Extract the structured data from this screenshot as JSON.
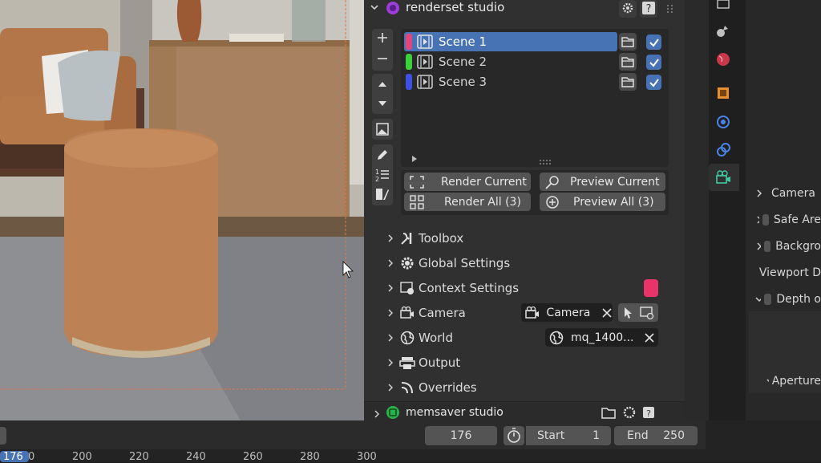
{
  "addon_header": {
    "title": "renderset studio"
  },
  "scenes": [
    {
      "name": "Scene 1",
      "color": "#e0467c",
      "selected": true,
      "checked": true
    },
    {
      "name": "Scene 2",
      "color": "#3ccf3c",
      "selected": false,
      "checked": true
    },
    {
      "name": "Scene 3",
      "color": "#3f50e0",
      "selected": false,
      "checked": true
    }
  ],
  "render_buttons": {
    "render_current": "Render Current",
    "preview_current": "Preview Current",
    "render_all": "Render All (3)",
    "preview_all": "Preview All (3)"
  },
  "sections": {
    "toolbox": "Toolbox",
    "global_settings": "Global Settings",
    "context_settings": "Context Settings",
    "camera": "Camera",
    "world": "World",
    "output": "Output",
    "overrides": "Overrides"
  },
  "context_color": "#e8336b",
  "camera_field": {
    "value": "Camera"
  },
  "world_field": {
    "value": "mq_1400..."
  },
  "memsaver_header": {
    "title": "memsaver studio"
  },
  "right_props": [
    "Camera",
    "Safe Are",
    "Backgro",
    "Viewport D",
    "Depth o",
    "Aperture"
  ],
  "timeline": {
    "current_frame": "176",
    "start_label": "Start",
    "start_value": "1",
    "end_label": "End",
    "end_value": "250",
    "ruler": [
      "176",
      "0",
      "200",
      "220",
      "240",
      "260",
      "280",
      "300"
    ]
  }
}
